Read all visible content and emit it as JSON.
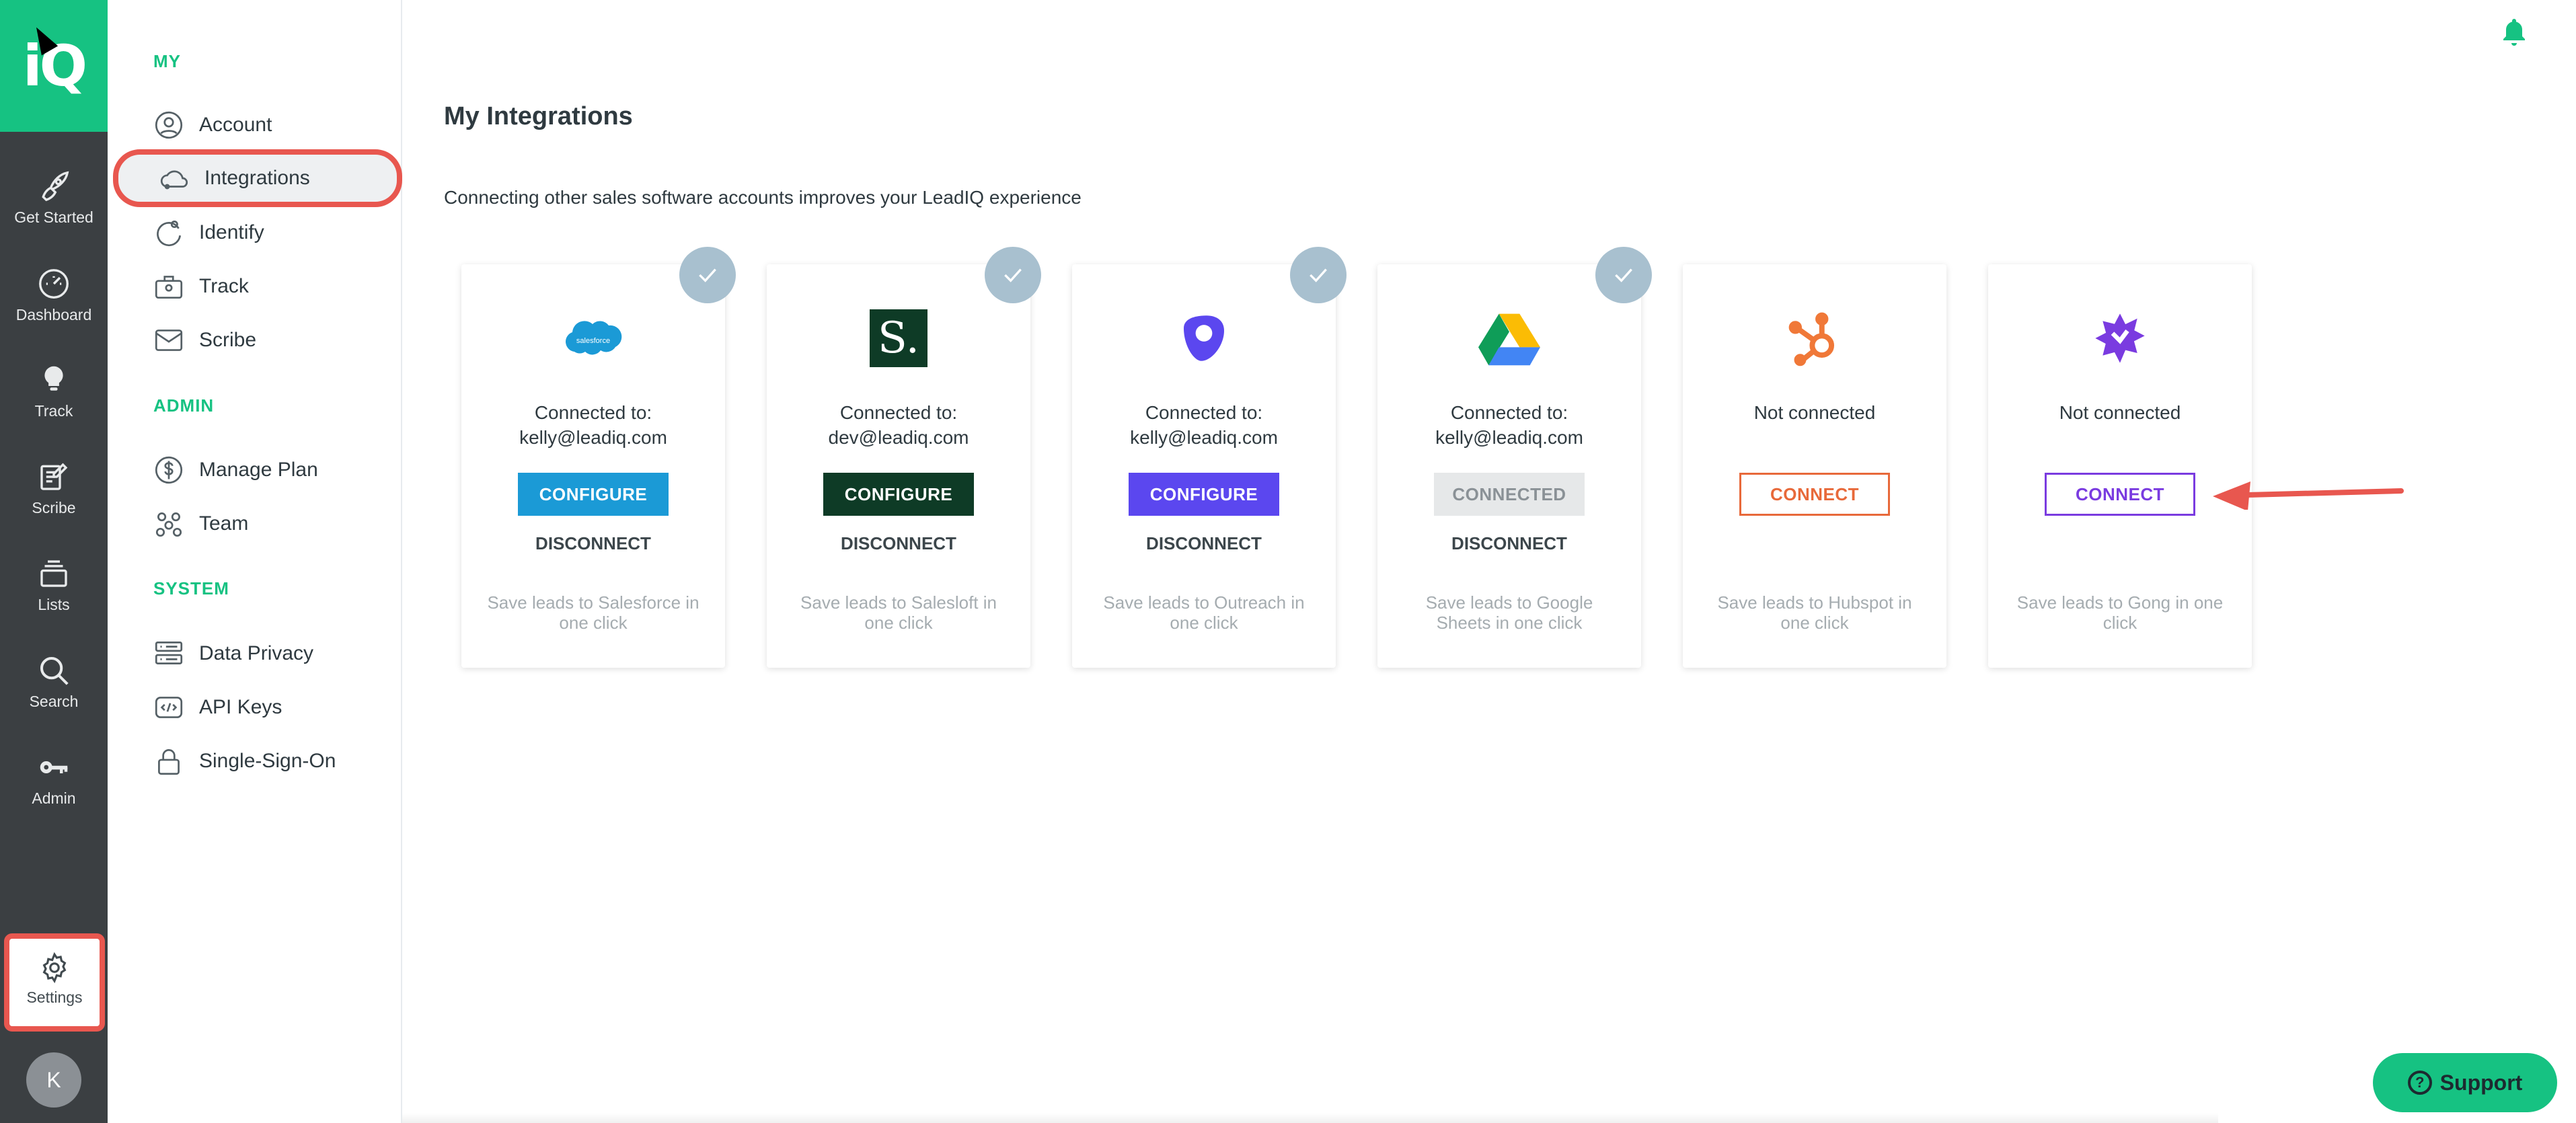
{
  "app": {
    "logo_text": "iQ"
  },
  "rail": {
    "items": [
      {
        "label": "Get Started",
        "icon": "rocket-icon"
      },
      {
        "label": "Dashboard",
        "icon": "speedometer-icon"
      },
      {
        "label": "Track",
        "icon": "lightbulb-icon"
      },
      {
        "label": "Scribe",
        "icon": "scribe-icon"
      },
      {
        "label": "Lists",
        "icon": "stack-icon"
      },
      {
        "label": "Search",
        "icon": "search-icon"
      },
      {
        "label": "Admin",
        "icon": "key-icon"
      }
    ],
    "settings_label": "Settings",
    "avatar_initial": "K"
  },
  "sidebar": {
    "my_heading": "MY",
    "my_items": [
      {
        "label": "Account",
        "icon": "user-circle-icon"
      },
      {
        "label": "Integrations",
        "icon": "cloud-icon"
      },
      {
        "label": "Identify",
        "icon": "identify-icon"
      },
      {
        "label": "Track",
        "icon": "briefcase-icon"
      },
      {
        "label": "Scribe",
        "icon": "mail-icon"
      }
    ],
    "admin_heading": "ADMIN",
    "admin_items": [
      {
        "label": "Manage Plan",
        "icon": "dollar-icon"
      },
      {
        "label": "Team",
        "icon": "team-icon"
      }
    ],
    "system_heading": "SYSTEM",
    "system_items": [
      {
        "label": "Data Privacy",
        "icon": "server-icon"
      },
      {
        "label": "API Keys",
        "icon": "code-icon"
      },
      {
        "label": "Single-Sign-On",
        "icon": "lock-icon"
      }
    ]
  },
  "main": {
    "title": "My Integrations",
    "subtitle": "Connecting other sales software accounts improves your LeadIQ experience"
  },
  "integrations": [
    {
      "name": "Salesforce",
      "logo_text": "salesforce",
      "status_line1": "Connected to:",
      "status_line2": "kelly@leadiq.com",
      "button": "CONFIGURE",
      "button_color": "#1b9ad6",
      "disconnect": "DISCONNECT",
      "description": "Save leads to Salesforce in one click",
      "connected": true
    },
    {
      "name": "Salesloft",
      "logo_text": "S.",
      "status_line1": "Connected to:",
      "status_line2": "dev@leadiq.com",
      "button": "CONFIGURE",
      "button_color": "#0e3b26",
      "disconnect": "DISCONNECT",
      "description": "Save leads to Salesloft in one click",
      "connected": true
    },
    {
      "name": "Outreach",
      "logo_text": "",
      "status_line1": "Connected to:",
      "status_line2": "kelly@leadiq.com",
      "button": "CONFIGURE",
      "button_color": "#5b47ef",
      "disconnect": "DISCONNECT",
      "description": "Save leads to Outreach in one click",
      "connected": true
    },
    {
      "name": "Google Sheets",
      "logo_text": "",
      "status_line1": "Connected to:",
      "status_line2": "kelly@leadiq.com",
      "button": "CONNECTED",
      "button_color": "#e6e8e9",
      "disconnect": "DISCONNECT",
      "description": "Save leads to Google Sheets in one click",
      "connected": true
    },
    {
      "name": "Hubspot",
      "logo_text": "",
      "status_line1": "Not connected",
      "status_line2": "",
      "button": "CONNECT",
      "button_color": "#e8693a",
      "disconnect": "",
      "description": "Save leads to Hubspot in one click",
      "connected": false
    },
    {
      "name": "Gong",
      "logo_text": "",
      "status_line1": "Not connected",
      "status_line2": "",
      "button": "CONNECT",
      "button_color": "#7a3be0",
      "disconnect": "",
      "description": "Save leads to Gong in one click",
      "connected": false
    }
  ],
  "support": {
    "label": "Support"
  },
  "colors": {
    "brand": "#16c282",
    "rail": "#3b3f42",
    "highlight": "#e8574f",
    "check": "#a8c0cf"
  }
}
